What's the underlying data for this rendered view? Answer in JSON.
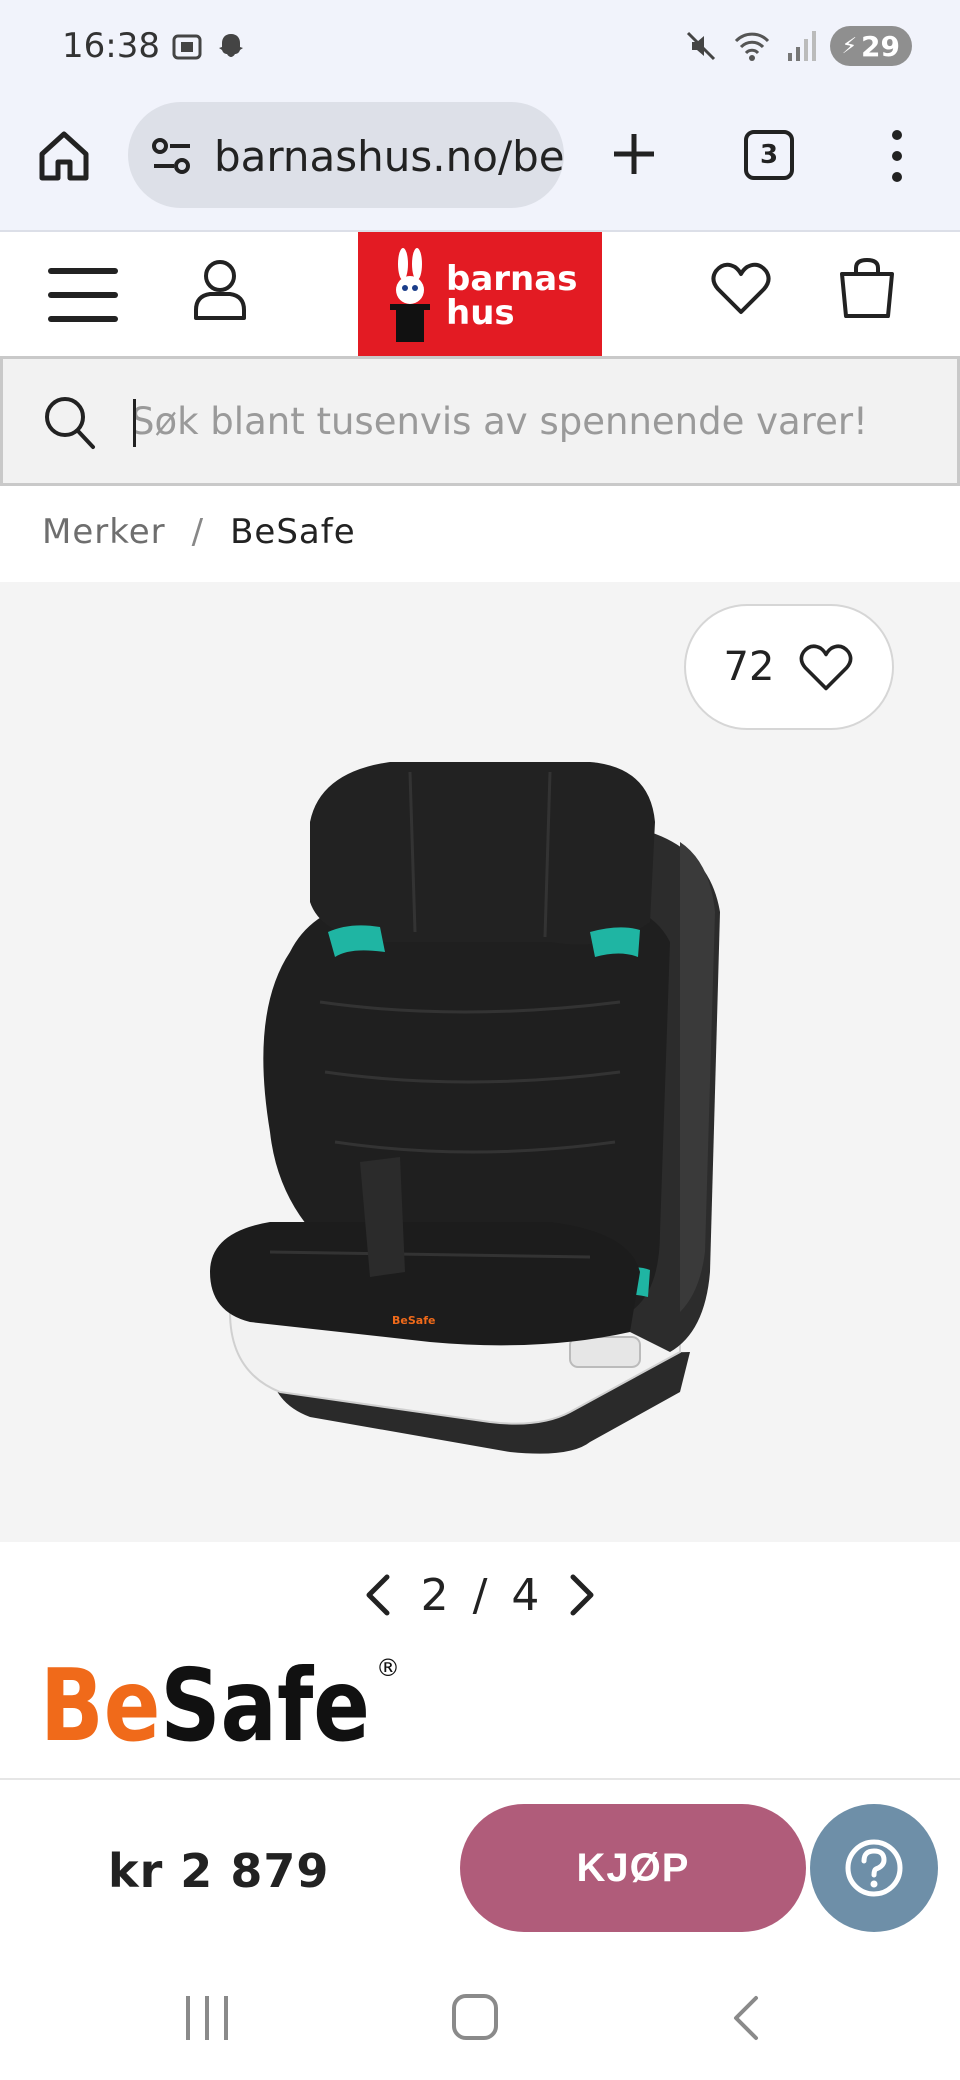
{
  "status_bar": {
    "time": "16:38",
    "battery": "29",
    "left_icons": [
      "screenshot-icon",
      "snapchat-icon"
    ],
    "right_icons": [
      "mute-icon",
      "wifi-icon",
      "signal-icon"
    ]
  },
  "browser": {
    "url": "barnashus.no/be",
    "tab_count": "3"
  },
  "site": {
    "logo_line1": "barnas",
    "logo_line2": "hus",
    "search_placeholder": "Søk blant tusenvis av spennende varer!",
    "brand_color": "#e31b23"
  },
  "breadcrumb": {
    "items": [
      "Merker",
      "BeSafe"
    ],
    "separator": "/"
  },
  "product": {
    "favorites_count": "72",
    "image_index": "2",
    "image_total": "4",
    "pager_separator": "/",
    "brand_logo_text": "BeSafe",
    "brand_logo_mark": "®",
    "seat_label": "BeSafe"
  },
  "purchase": {
    "price": "kr 2 879",
    "buy_label": "KJØP",
    "buy_color": "#b05c7a",
    "help_color": "#6e8fa8"
  }
}
